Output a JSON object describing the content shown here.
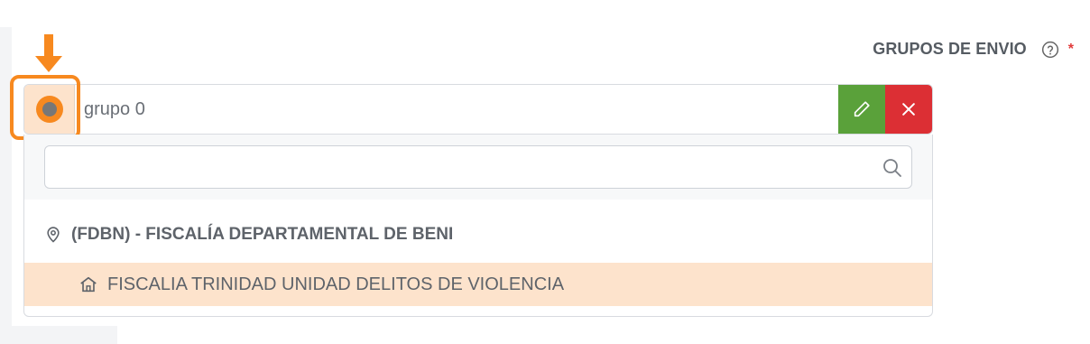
{
  "field": {
    "label": "GRUPOS DE ENVIO",
    "help_icon": "question-circle-icon",
    "required_mark": "*"
  },
  "combo": {
    "value": "grupo 0",
    "radio_selected": true,
    "edit_icon": "pencil-icon",
    "remove_icon": "close-icon"
  },
  "dropdown": {
    "search_value": "",
    "search_icon": "search-icon",
    "group": {
      "icon": "map-pin-icon",
      "label": "(FDBN) - FISCALÍA DEPARTAMENTAL DE BENI"
    },
    "options": [
      {
        "icon": "home-icon",
        "label": "FISCALIA TRINIDAD UNIDAD DELITOS DE VIOLENCIA",
        "highlighted": true
      }
    ]
  },
  "annotation": {
    "color": "#f7891f"
  },
  "colors": {
    "accent": "#f7891f",
    "edit": "#5aa13a",
    "remove": "#dc2f34",
    "highlight_bg": "#fde3cc",
    "required": "#e23b3b"
  }
}
